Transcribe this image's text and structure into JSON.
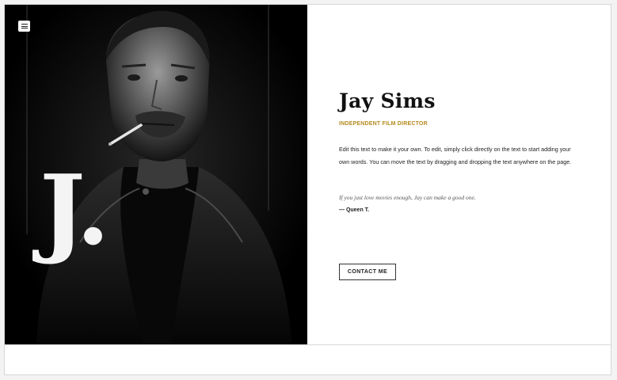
{
  "header": {
    "menu_icon": "hamburger-menu-icon"
  },
  "hero": {
    "monogram": "J.",
    "photo_description_icon": "portrait-photo"
  },
  "profile": {
    "name": "Jay Sims",
    "role": "INDEPENDENT FILM DIRECTOR",
    "bio": "Edit this text to make it your own. To edit, simply click directly on the text to start adding your own words. You can move the text by dragging and dropping the text anywhere on the page.",
    "quote": "If you just love movies enough, Jay can make a good one.",
    "quote_author": "— Queen T.",
    "contact_label": "CONTACT ME"
  },
  "colors": {
    "accent": "#b48a1e",
    "photo_bg": "#000000",
    "text": "#111111"
  }
}
